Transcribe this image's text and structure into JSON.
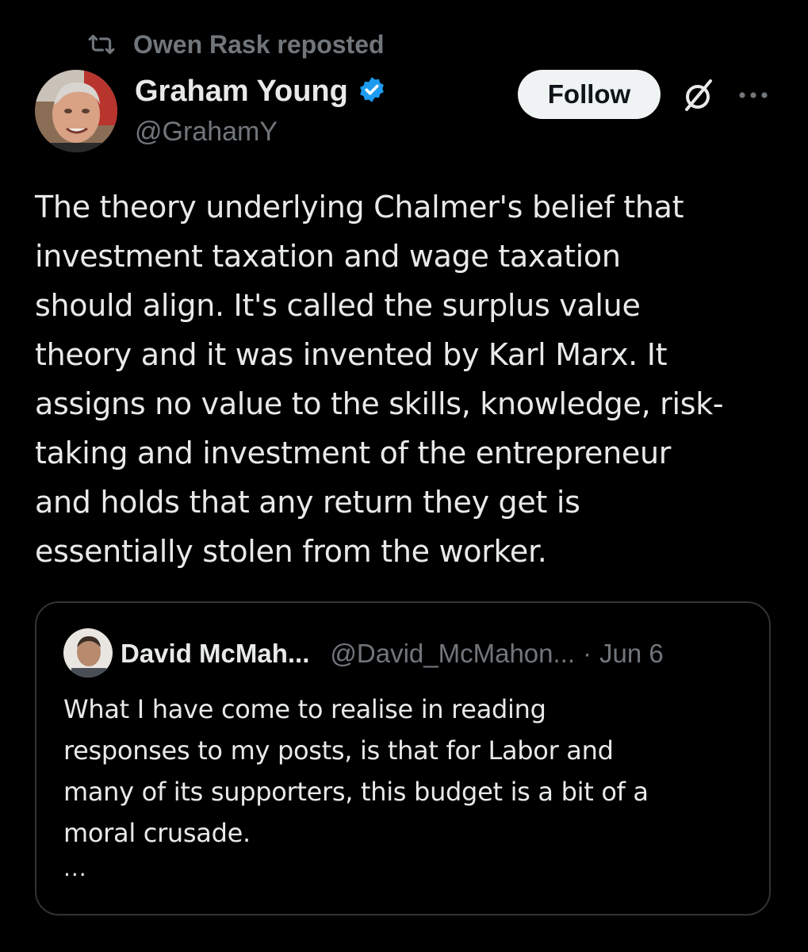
{
  "repost": {
    "text": "Owen Rask reposted",
    "icon": "repost-icon"
  },
  "post": {
    "author_name": "Graham Young",
    "handle": "@GrahamY",
    "verified_icon": "verified-badge-icon",
    "follow_label": "Follow",
    "text": "The theory underlying Chalmer's belief that\ninvestment taxation and wage taxation\nshould align. It's called the surplus value\ntheory and it was invented by Karl Marx. It\nassigns no value to the skills, knowledge, risk-\ntaking and investment of the entrepreneur\nand holds that any return they get is\nessentially stolen from the worker."
  },
  "quote": {
    "author_name": "David McMah...",
    "handle": "@David_McMahon...",
    "separator": "·",
    "date": "Jun 6",
    "text": "What I have come to realise in reading\nresponses to my posts, is that for Labor and\nmany of its supporters, this budget is a bit of a\nmoral crusade.",
    "ellipsis": "..."
  },
  "colors": {
    "background": "#000000",
    "text_primary": "#e7e9ea",
    "text_secondary": "#71767b",
    "verified_blue": "#1d9bf0",
    "button_bg": "#eff3f4",
    "border": "#2f3336"
  }
}
